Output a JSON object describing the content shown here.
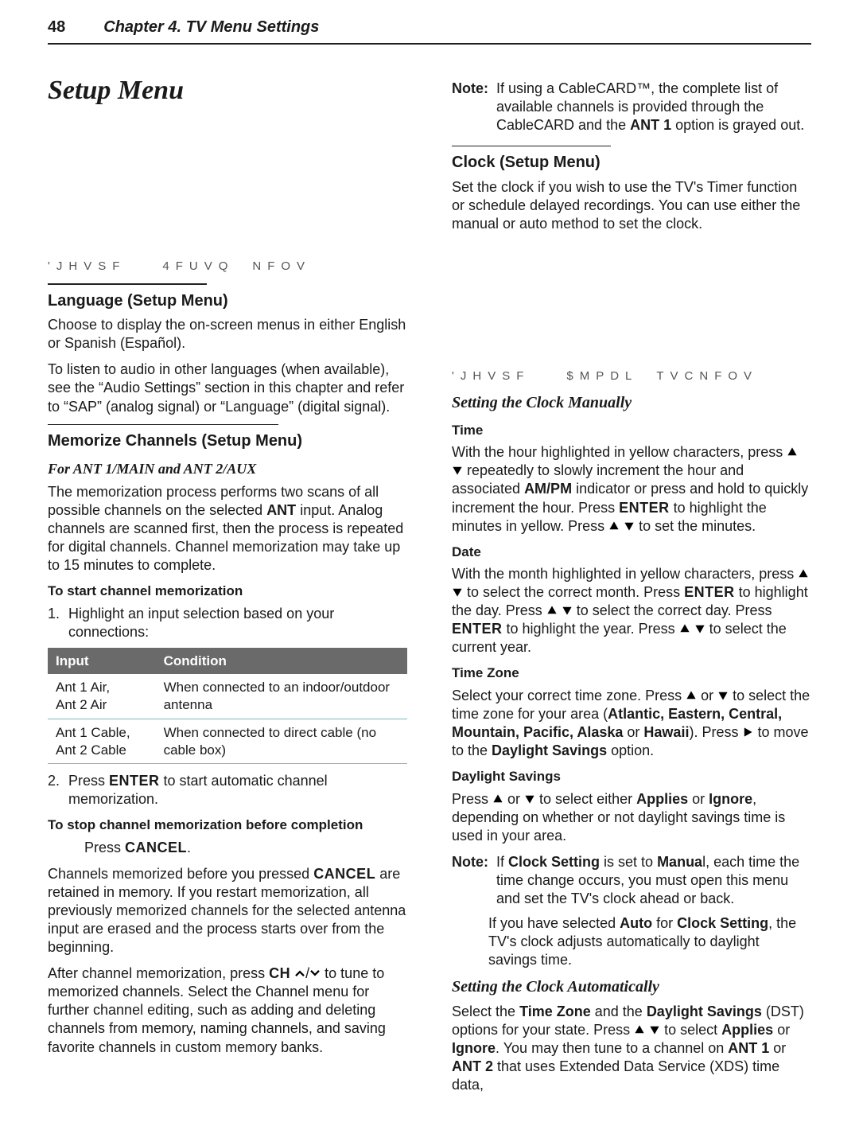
{
  "page_number": "48",
  "chapter_title": "Chapter 4. TV Menu Settings",
  "setup_menu_title": "Setup Menu",
  "left": {
    "figure_cap": "'JHVSF  4FUVQ NFOV",
    "lang_hd": "Language (Setup Menu)",
    "lang_p1": "Choose to display the on-screen menus in either English or Spanish (Español).",
    "lang_p2": "To listen to audio in other languages (when available), see the “Audio Settings” section in this chapter and refer to “SAP” (analog signal) or “Language” (digital signal).",
    "mem_hd": "Memorize Channels (Setup Menu)",
    "mem_sub": "For ANT 1/MAIN and ANT 2/AUX",
    "mem_p1a": "The memorization process performs two scans of all possible channels on the selected ",
    "mem_p1_ant": "ANT",
    "mem_p1b": " input. Analog channels are scanned first, then the process is repeated for digital channels. Channel memorization may take up to 15 minutes to complete.",
    "mem_start_hd": "To start channel memorization",
    "mem_step1": "Highlight an input selection based on your connections:",
    "tbl_h1": "Input",
    "tbl_h2": "Condition",
    "tbl_r0c0": "Ant 1 Air,\nAnt 2 Air",
    "tbl_r0c1": "When connected to an indoor/outdoor antenna",
    "tbl_r1c0": "Ant 1 Cable,\nAnt 2 Cable",
    "tbl_r1c1": "When connected to direct cable (no cable box)",
    "mem_step2_a": "Press ",
    "mem_step2_enter": "ENTER",
    "mem_step2_b": " to start automatic channel memorization.",
    "mem_stop_hd": "To stop channel memorization before completion",
    "mem_stop_press": "Press ",
    "mem_stop_cancel": "CANCEL",
    "mem_stop_dot": ".",
    "mem_after_a": "Channels memorized before you pressed ",
    "mem_after_cancel": "CANCEL",
    "mem_after_b": " are retained in memory. If you restart memorization, all previously memorized channels for the selected antenna input are erased and the process starts over from the beginning.",
    "mem_tune_a": "After channel memorization, press ",
    "mem_tune_ch": "CH",
    "mem_tune_b": " to tune to memorized channels. Select the Channel menu for further channel editing, such as adding and deleting channels from memory, naming channels, and saving favorite channels in custom memory banks."
  },
  "right": {
    "note1_lbl": "Note:",
    "note1_txt_a": "If using a CableCARD™, the complete list of available channels is provided through the CableCARD and the ",
    "note1_ant1": "ANT 1",
    "note1_txt_b": " option is grayed out.",
    "clock_hd": "Clock (Setup Menu)",
    "clock_p1": "Set the clock if you wish to use the TV's Timer function or schedule delayed recordings. You can use either the manual or auto method to set the clock.",
    "figure_cap": "'JHVSF  $MPDL TVCNFOV",
    "manual_hd": "Setting the Clock Manually",
    "time_hd": "Time",
    "time_a": "With the hour highlighted in yellow characters, press ",
    "time_b": " repeatedly to slowly increment the hour and associated ",
    "time_ampm": "AM/PM",
    "time_c": " indicator or press and hold to quickly increment the hour. Press ",
    "time_enter": "ENTER",
    "time_d": " to highlight the minutes in yellow. Press ",
    "time_e": " to set the minutes.",
    "date_hd": "Date",
    "date_a": "With the month highlighted in yellow characters, press ",
    "date_b": " to select the correct month. Press ",
    "date_enter1": "ENTER",
    "date_c": " to highlight the day. Press ",
    "date_d": " to select the correct day. Press ",
    "date_enter2": "ENTER",
    "date_e": " to highlight the year. Press ",
    "date_f": " to select the current year.",
    "tz_hd": "Time Zone",
    "tz_a": "Select your correct time zone. Press ",
    "tz_or": " or ",
    "tz_b": " to select the time zone for your area (",
    "tz_list": "Atlantic, Eastern, Central, Mountain, Pacific, Alaska",
    "tz_or2": " or ",
    "tz_hawaii": "Hawaii",
    "tz_c": "). Press ",
    "tz_d": " to move to the ",
    "tz_dst": "Daylight Savings",
    "tz_e": " option.",
    "ds_hd": "Daylight Savings",
    "ds_a": "Press ",
    "ds_or": " or ",
    "ds_b": " to select either ",
    "ds_applies": "Applies",
    "ds_or2": " or ",
    "ds_ignore": "Ignore",
    "ds_c": ", depending on whether or not daylight savings time is used in your area.",
    "note2_lbl": "Note:",
    "note2_a": "If ",
    "note2_cs": "Clock Setting",
    "note2_b": " is set to ",
    "note2_manual": "Manua",
    "note2_c": "l, each time the time change occurs, you must open this menu and set the TV's clock ahead or back.",
    "note2_p2_a": "If you have selected ",
    "note2_auto": "Auto",
    "note2_p2_b": " for ",
    "note2_cs2": "Clock Setting",
    "note2_p2_c": ", the TV's clock adjusts automatically to daylight savings time.",
    "auto_hd": "Setting the Clock Automatically",
    "auto_a": "Select the ",
    "auto_tz": "Time Zone",
    "auto_b": " and the ",
    "auto_dst": "Daylight Savings",
    "auto_c": " (DST) options for your state. Press ",
    "auto_d": " to select ",
    "auto_applies": "Applies",
    "auto_or": " or ",
    "auto_ignore": "Ignore",
    "auto_e": ". You may then tune to a channel on ",
    "auto_ant1": "ANT 1",
    "auto_or2": " or ",
    "auto_ant2": "ANT 2",
    "auto_f": " that uses Extended Data Service (XDS) time data,"
  }
}
